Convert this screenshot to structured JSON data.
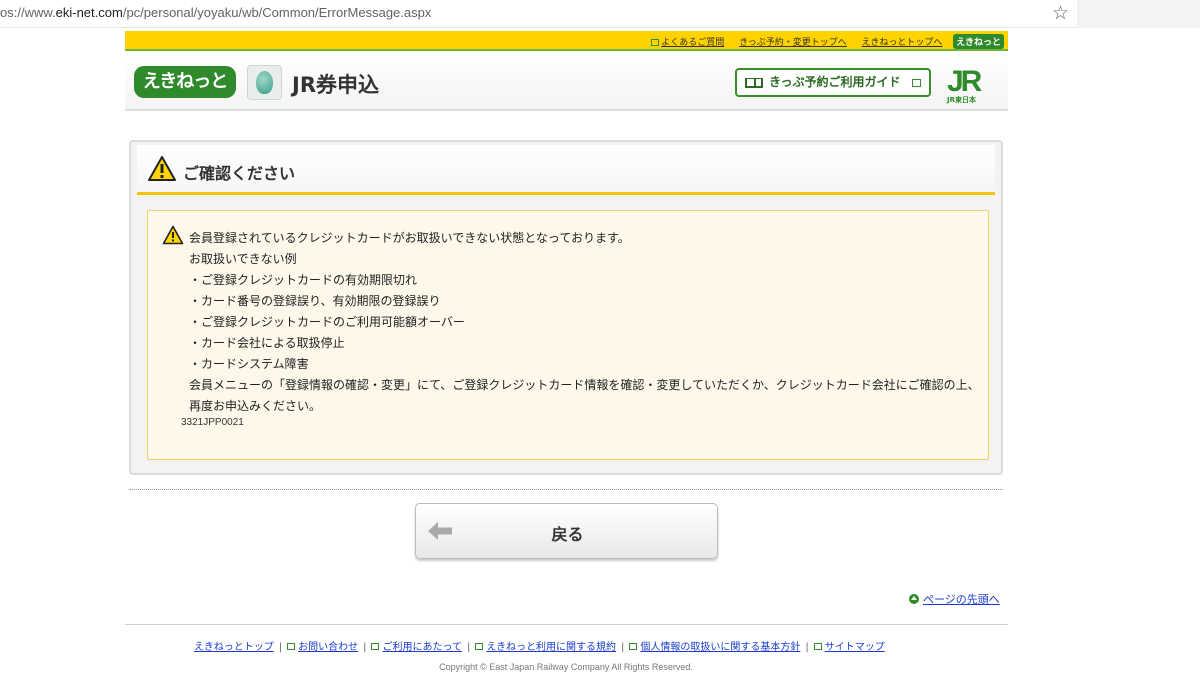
{
  "browser": {
    "url_prefix": "os://www.",
    "url_host": "eki-net.com",
    "url_path": "/pc/personal/yoyaku/wb/Common/ErrorMessage.aspx"
  },
  "toplinks": [
    "よくあるご質問",
    "きっぷ予約・変更トップへ",
    "えきねっとトップへ"
  ],
  "mini_logo": "えきねっと",
  "header": {
    "logo": "えきねっと",
    "title": "JR券申込",
    "guide_button": "きっぷ予約ご利用ガイド",
    "jr_logo": "JR",
    "jr_sub": "JR東日本"
  },
  "panel": {
    "title": "ご確認ください",
    "message_lines": [
      "会員登録されているクレジットカードがお取扱いできない状態となっております。",
      "お取扱いできない例",
      "・ご登録クレジットカードの有効期限切れ",
      "・カード番号の登録誤り、有効期限の登録誤り",
      "・ご登録クレジットカードのご利用可能額オーバー",
      "・カード会社による取扱停止",
      "・カードシステム障害",
      "会員メニューの「登録情報の確認・変更」にて、ご登録クレジットカード情報を確認・変更していただくか、クレジットカード会社にご確認の上、",
      "再度お申込みください。"
    ],
    "error_code": "3321JPP0021"
  },
  "back_button": "戻る",
  "page_top_link": "ページの先頭へ",
  "footer": {
    "links": [
      "えきねっとトップ",
      "お問い合わせ",
      "ご利用にあたって",
      "えきねっと利用に関する規約",
      "個人情報の取扱いに関する基本方針",
      "サイトマップ"
    ],
    "copyright": "Copyright © East Japan Railway Company All Rights Reserved."
  }
}
